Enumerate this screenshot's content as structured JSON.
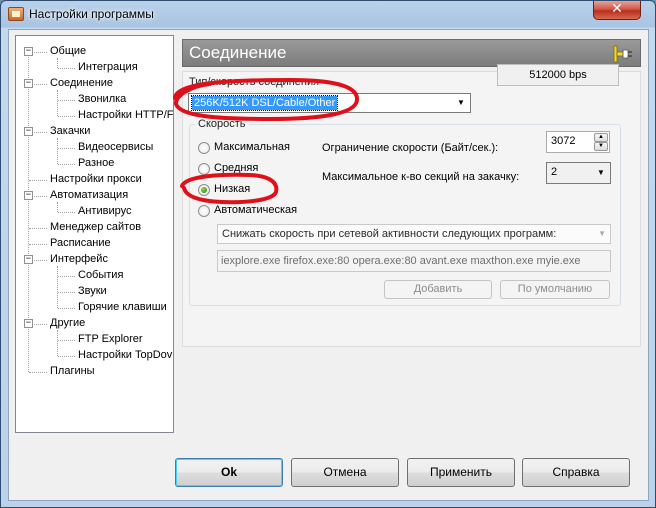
{
  "window": {
    "title": "Настройки программы",
    "close_glyph": "✕"
  },
  "tree": {
    "items": [
      {
        "label": "Общие",
        "level": 0,
        "expander": "−"
      },
      {
        "label": "Интеграция",
        "level": 1
      },
      {
        "label": "Соединение",
        "level": 0,
        "expander": "−"
      },
      {
        "label": "Звонилка",
        "level": 1
      },
      {
        "label": "Настройки HTTP/F",
        "level": 1
      },
      {
        "label": "Закачки",
        "level": 0,
        "expander": "−"
      },
      {
        "label": "Видеосервисы",
        "level": 1
      },
      {
        "label": "Разное",
        "level": 1
      },
      {
        "label": "Настройки прокси",
        "level": 0
      },
      {
        "label": "Автоматизация",
        "level": 0,
        "expander": "−"
      },
      {
        "label": "Антивирус",
        "level": 1
      },
      {
        "label": "Менеджер сайтов",
        "level": 0
      },
      {
        "label": "Расписание",
        "level": 0
      },
      {
        "label": "Интерфейс",
        "level": 0,
        "expander": "−"
      },
      {
        "label": "События",
        "level": 1
      },
      {
        "label": "Звуки",
        "level": 1
      },
      {
        "label": "Горячие клавиши",
        "level": 1
      },
      {
        "label": "Другие",
        "level": 0,
        "expander": "−"
      },
      {
        "label": "FTP Explorer",
        "level": 1
      },
      {
        "label": "Настройки TopDov",
        "level": 1
      },
      {
        "label": "Плагины",
        "level": 0
      }
    ]
  },
  "panel": {
    "title": "Соединение",
    "icon": "plug-icon",
    "connection": {
      "label": "Тип/скорость соединения",
      "selected": "256K/512K DSL/Cable/Other",
      "bps": "512000 bps"
    },
    "speed": {
      "label": "Скорость",
      "options": [
        "Максимальная",
        "Средняя",
        "Низкая",
        "Автоматическая"
      ],
      "selected": "Низкая",
      "limit_label": "Ограничение скорости (Байт/сек.):",
      "limit_value": "3072",
      "sections_label": "Максимальное к-во секций на закачку:",
      "sections_value": "2",
      "auto_combo": "Снижать скорость при сетевой активности следующих программ:",
      "programs": "iexplore.exe firefox.exe:80 opera.exe:80 avant.exe maxthon.exe myie.exe",
      "add_button": "Добавить",
      "default_button": "По умолчанию"
    }
  },
  "buttons": {
    "ok": "Ok",
    "cancel": "Отмена",
    "apply": "Применить",
    "help": "Справка"
  },
  "colors": {
    "annotation_red": "#e0101a",
    "selection_blue": "#3399ff",
    "header_gray": "#8a8a8a"
  }
}
